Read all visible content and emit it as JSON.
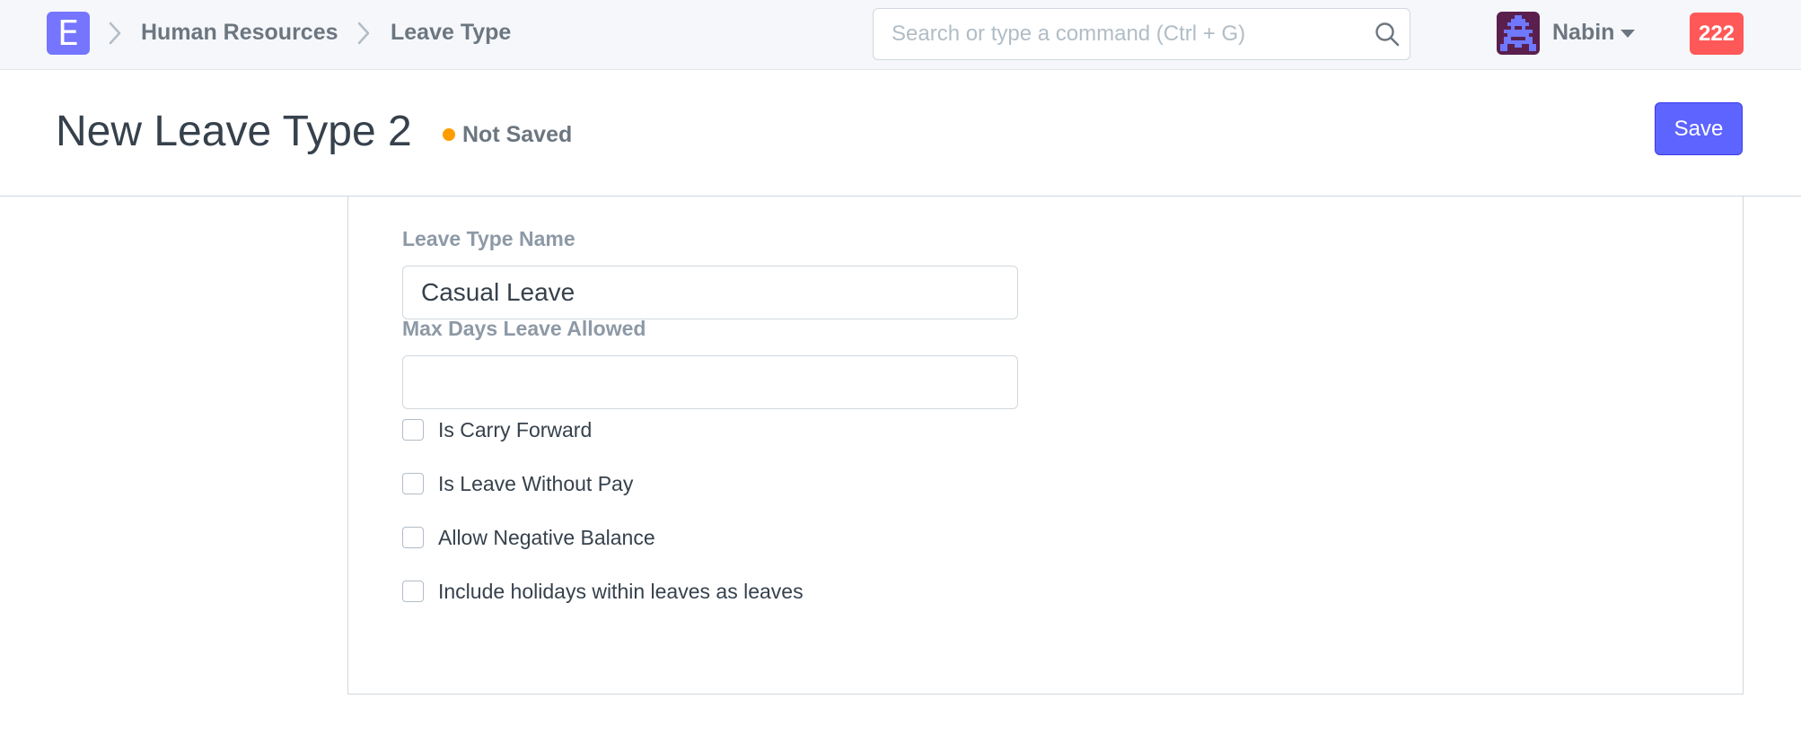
{
  "navbar": {
    "logo_letter": "E",
    "breadcrumbs": [
      {
        "label": "Human Resources"
      },
      {
        "label": "Leave Type"
      }
    ],
    "search": {
      "placeholder": "Search or type a command (Ctrl + G)",
      "value": ""
    },
    "user": {
      "name": "Nabin"
    },
    "notifications": {
      "count": "222"
    }
  },
  "page": {
    "title": "New Leave Type 2",
    "status": "Not Saved",
    "save_label": "Save"
  },
  "form": {
    "leave_type_name": {
      "label": "Leave Type Name",
      "value": "Casual Leave"
    },
    "max_days_allowed": {
      "label": "Max Days Leave Allowed",
      "value": ""
    },
    "checkboxes": [
      {
        "label": "Is Carry Forward",
        "checked": false
      },
      {
        "label": "Is Leave Without Pay",
        "checked": false
      },
      {
        "label": "Allow Negative Balance",
        "checked": false
      },
      {
        "label": "Include holidays within leaves as leaves",
        "checked": false
      }
    ]
  },
  "colors": {
    "brand": "#7575ff",
    "primary_button": "#5e64ff",
    "status_dot": "#ff9d00",
    "notification": "#ff5858"
  },
  "icons": {
    "breadcrumb_separator": "chevron-right-icon",
    "search": "search-icon",
    "user_menu": "caret-down-icon",
    "avatar": "pixel-avatar"
  }
}
